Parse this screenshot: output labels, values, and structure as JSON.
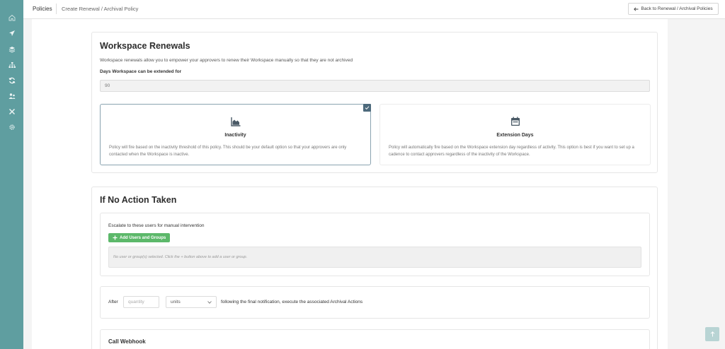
{
  "topbar": {
    "section": "Policies",
    "subtitle": "Create Renewal / Archival Policy",
    "back_label": "Back to Renewal / Archival Policies"
  },
  "sidebar": {
    "items": [
      {
        "icon": "home-icon"
      },
      {
        "icon": "paper-plane-icon"
      },
      {
        "icon": "layers-icon"
      },
      {
        "icon": "sitemap-icon"
      },
      {
        "icon": "sync-icon",
        "active": true
      },
      {
        "icon": "users-icon"
      },
      {
        "icon": "tools-icon"
      },
      {
        "icon": "gear-icon"
      }
    ]
  },
  "renewals": {
    "title": "Workspace Renewals",
    "description": "Workspace renewals allow you to empower your approvers to renew their Workspace manually so that they are not archived",
    "days_label": "Days Workspace can be extended for",
    "days_value": "90",
    "options": [
      {
        "title": "Inactivity",
        "icon": "area-chart-icon",
        "selected": true,
        "description": "Policy will fire based on the inactivity threshold of this policy. This should be your default option so that your approvers are only contacted when the Workspace is inactive."
      },
      {
        "title": "Extension Days",
        "icon": "calendar-icon",
        "selected": false,
        "description": "Policy will automatically fire based on the Workspace extension day regardless of activity. This option is best if you want to set up a cadence to contact approvers regardless of the inactivity of the Workspace."
      }
    ]
  },
  "no_action": {
    "title": "If No Action Taken",
    "escalate_label": "Escalate to these users for manual intervention",
    "add_button": "Add Users and Groups",
    "empty_text": "No user or group(s) selected. Click the + button above to add a user or group.",
    "after_label": "After",
    "quantity_placeholder": "quantity",
    "units_value": "units",
    "after_suffix": "following the final notification, execute the associated Archival Actions"
  },
  "webhook": {
    "title": "Call Webhook"
  },
  "colors": {
    "sidebar": "#5f9ea0",
    "accent_green": "#5cb86a",
    "check": "#4d6a7c"
  }
}
